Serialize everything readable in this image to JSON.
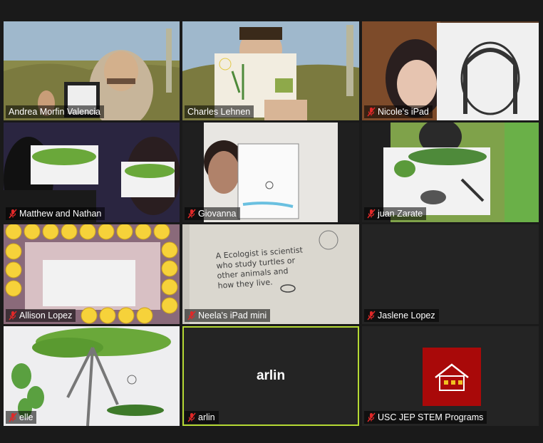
{
  "participants": [
    {
      "name": "Andrea Morfin Valencia",
      "muted": false,
      "content": "Holding tablet with drawing, thumbs up",
      "video": true
    },
    {
      "name": "Charles Lehnen",
      "muted": false,
      "content": "Holding drawing of scarecrow and cactus",
      "video": true
    },
    {
      "name": "Nicole's iPad",
      "muted": true,
      "content": "Holding drawing of girl with dark hair",
      "video": true
    },
    {
      "name": "Matthew and Nathan",
      "muted": true,
      "content": "Two kids holding tree drawings",
      "video": true
    },
    {
      "name": "Giovanna",
      "muted": true,
      "content": "Holding notebook with drawing",
      "video": true
    },
    {
      "name": "juan Zarate",
      "muted": true,
      "content": "Holding drawing of trees and animals",
      "video": true
    },
    {
      "name": "Allison Lopez",
      "muted": true,
      "content": "Emoji frame filter",
      "video": true
    },
    {
      "name": "Neela's iPad mini",
      "muted": true,
      "content": "A Ecologist is scientist who study turtles or other animals and how they live",
      "video": true
    },
    {
      "name": "Jaslene Lopez",
      "muted": true,
      "video": false
    },
    {
      "name": "elle",
      "muted": true,
      "content": "Drawing of tree, cactus and iguana",
      "video": true
    },
    {
      "name": "arlin",
      "muted": true,
      "video": false,
      "display_name": "arlin",
      "active_speaker": true
    },
    {
      "name": "USC JEP STEM Programs",
      "muted": true,
      "video": false,
      "logo": true
    }
  ],
  "neela_text": [
    "A Ecologist is scientist",
    "who study turtles or",
    "other animals and",
    "how they live."
  ],
  "colors": {
    "active_border": "#b5d934",
    "muted_icon": "#e02828",
    "logo_bg": "#a90909"
  }
}
